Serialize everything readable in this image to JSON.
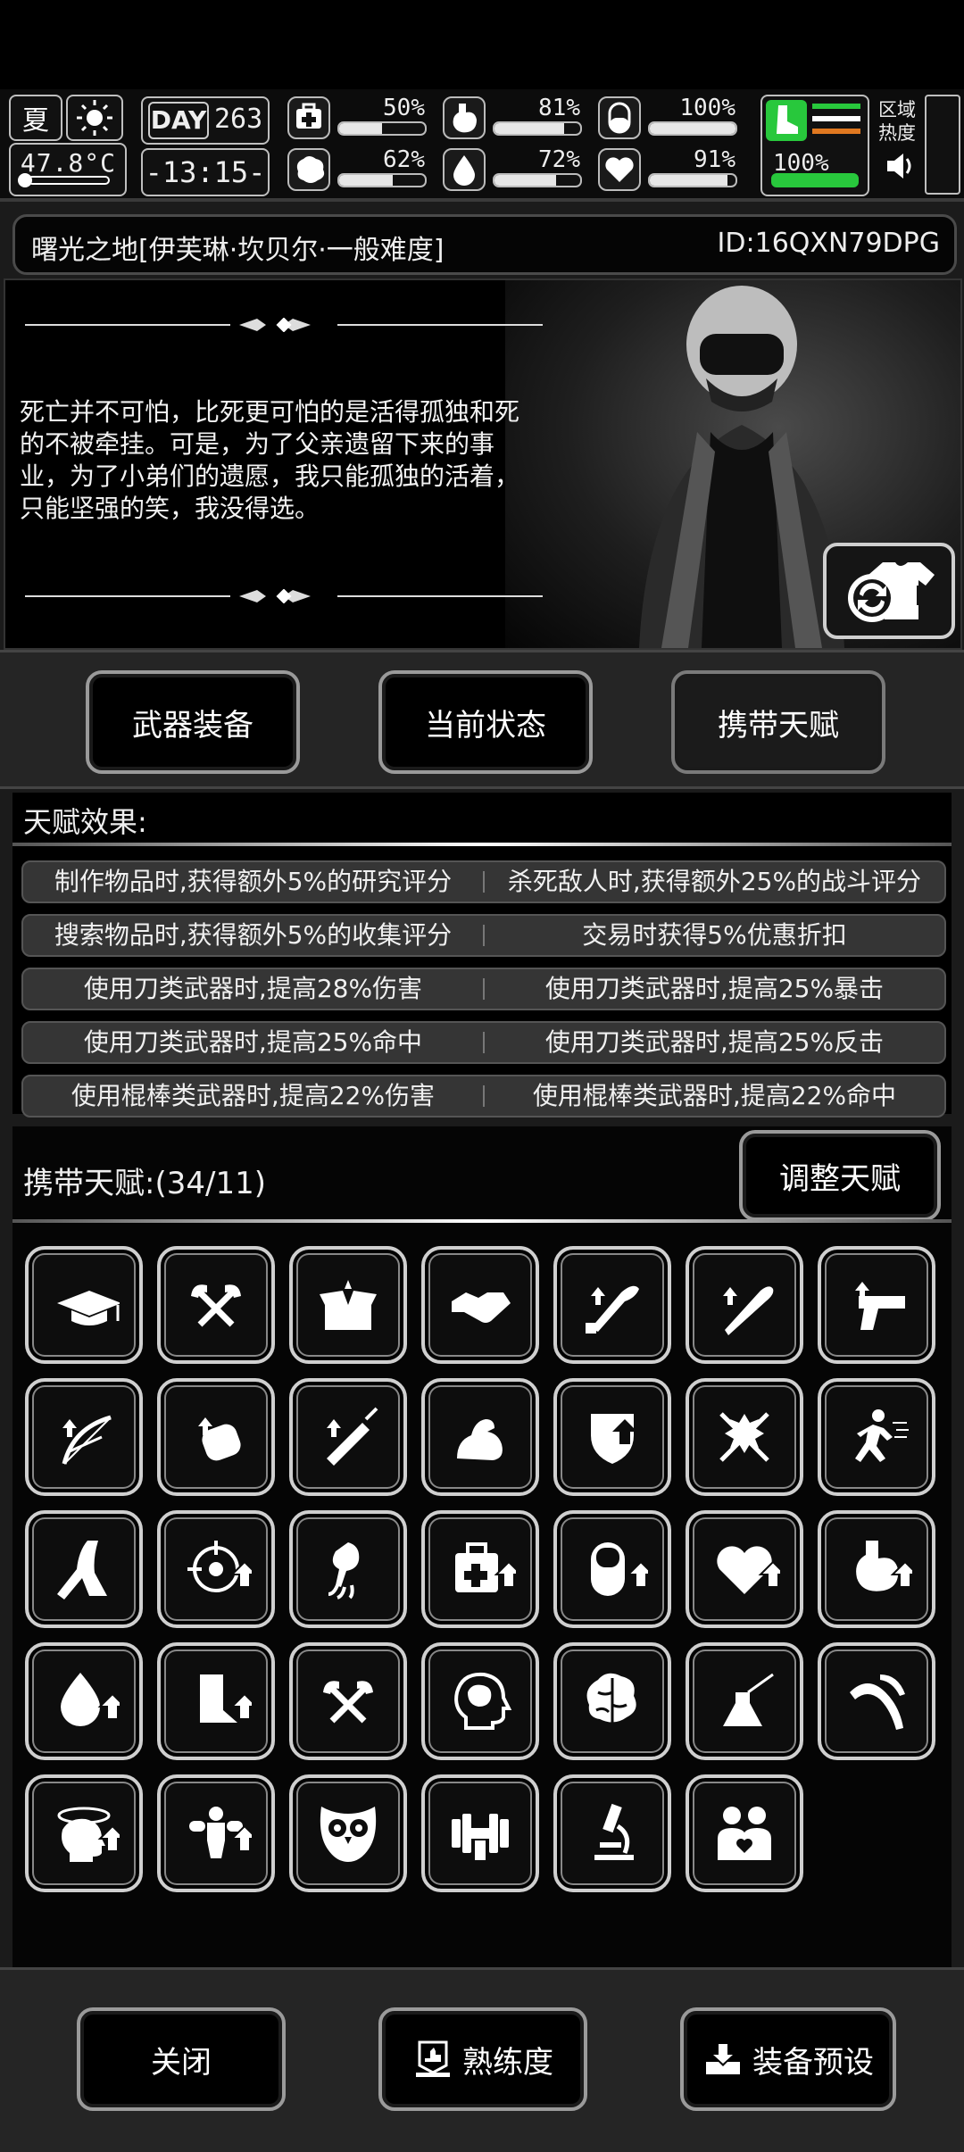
{
  "status": {
    "season": "夏",
    "temperature": "47.8°C",
    "day_label": "DAY",
    "day": "263",
    "clock": "-13:15-",
    "stats": [
      {
        "name": "health",
        "icon": "medkit-icon",
        "pct_text": "50%",
        "value": 0.5
      },
      {
        "name": "hunger",
        "icon": "stomach-icon",
        "pct_text": "81%",
        "value": 0.81
      },
      {
        "name": "pills",
        "icon": "pill-icon",
        "pct_text": "100%",
        "value": 1.0
      },
      {
        "name": "sanity",
        "icon": "brain-icon",
        "pct_text": "62%",
        "value": 0.62
      },
      {
        "name": "thirst",
        "icon": "water-drop-icon",
        "pct_text": "72%",
        "value": 0.72
      },
      {
        "name": "mood",
        "icon": "heart-icon",
        "pct_text": "91%",
        "value": 0.91
      }
    ],
    "boot_pct": "100%",
    "boot_value": 1.0,
    "zone_heat_label": "区域\n热度",
    "colors": {
      "green": "#28c83c",
      "orange": "#e07820"
    }
  },
  "title": {
    "name": "曙光之地[伊芙琳·坎贝尔·一般难度]",
    "id": "ID:16QXN79DPG"
  },
  "portrait": {
    "quote": "死亡并不可怕，比死更可怕的是活得孤独和死的不被牵挂。可是，为了父亲遗留下来的事业，为了小弟们的遗愿，我只能孤独的活着，只能坚强的笑，我没得选。"
  },
  "tabs": [
    {
      "label": "武器装备",
      "active": false
    },
    {
      "label": "当前状态",
      "active": false
    },
    {
      "label": "携带天赋",
      "active": true
    }
  ],
  "effects": {
    "title": "天赋效果:",
    "rows": [
      [
        "制作物品时,获得额外5%的研究评分",
        "杀死敌人时,获得额外25%的战斗评分"
      ],
      [
        "搜索物品时,获得额外5%的收集评分",
        "交易时获得5%优惠折扣"
      ],
      [
        "使用刀类武器时,提高28%伤害",
        "使用刀类武器时,提高25%暴击"
      ],
      [
        "使用刀类武器时,提高25%命中",
        "使用刀类武器时,提高25%反击"
      ],
      [
        "使用棍棒类武器时,提高22%伤害",
        "使用棍棒类武器时,提高22%命中"
      ]
    ]
  },
  "carry": {
    "title": "携带天赋:(34/11)",
    "adjust_label": "调整天赋",
    "talents": [
      "graduation-cap-icon",
      "crossed-axes-icon",
      "open-box-icon",
      "handshake-icon",
      "machete-up-icon",
      "bat-up-icon",
      "pistol-up-icon",
      "bow-up-icon",
      "fist-up-icon",
      "syringe-up-icon",
      "muscle-arm-icon",
      "shield-up-icon",
      "crossed-swords-icon",
      "running-man-icon",
      "leg-icon",
      "crosshair-up-icon",
      "claw-arm-icon",
      "medkit-up-icon",
      "pill-up-icon",
      "heart-up-icon",
      "stomach-up-icon",
      "drop-up-icon",
      "leg-up-icon",
      "crossed-axes-icon",
      "head-brain-icon",
      "brain-icon",
      "flask-icon",
      "tentacle-icon",
      "dizzy-head-up-icon",
      "punch-up-icon",
      "owl-icon",
      "dumbbell-icon",
      "microscope-icon",
      "couple-icon"
    ]
  },
  "bottom": {
    "close_label": "关闭",
    "proficiency_label": "熟练度",
    "preset_label": "装备预设"
  }
}
